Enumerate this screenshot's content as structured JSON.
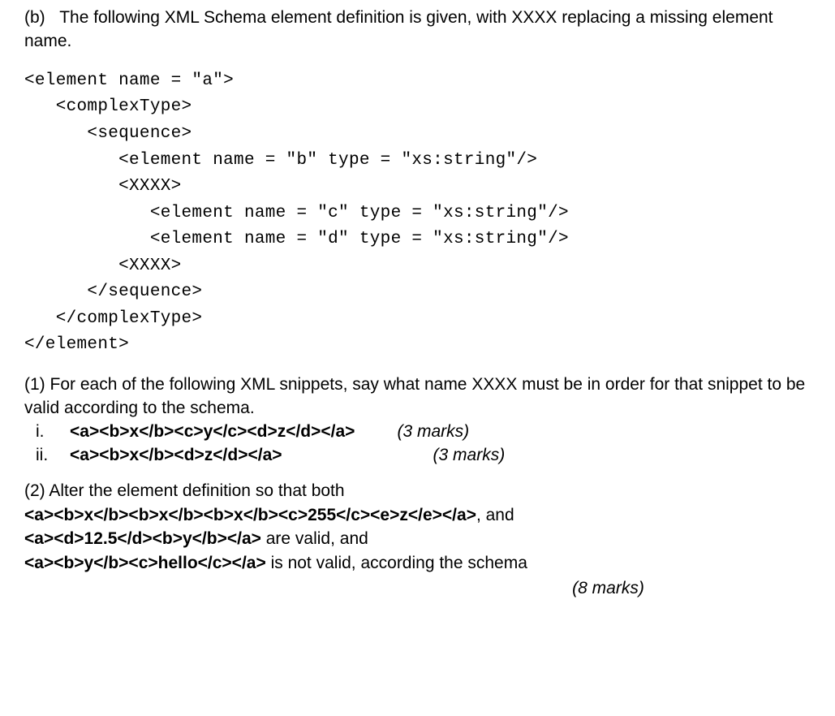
{
  "intro": {
    "label": "(b)",
    "text_part1": "The following XML Schema element definition is given, with XXXX replacing a missing element name."
  },
  "code": {
    "line1": "<element name = \"a\">",
    "line2": "   <complexType>",
    "line3": "      <sequence>",
    "line4": "         <element name = \"b\" type = \"xs:string\"/>",
    "line5": "         <XXXX>",
    "line6": "            <element name = \"c\" type = \"xs:string\"/>",
    "line7": "            <element name = \"d\" type = \"xs:string\"/>",
    "line8": "         <XXXX>",
    "line9": "      </sequence>",
    "line10": "   </complexType>",
    "line11": "</element>"
  },
  "q1": {
    "prompt": "(1) For each of the following XML snippets, say what name XXXX must be in order for that snippet to be valid according to the schema.",
    "items": [
      {
        "roman": "i.",
        "snippet": "<a><b>x</b><c>y</c><d>z</d></a>",
        "marks": "(3 marks)"
      },
      {
        "roman": "ii.",
        "snippet": "<a><b>x</b><d>z</d></a>",
        "marks": "(3 marks)"
      }
    ]
  },
  "q2": {
    "line1_prefix": "(2) Alter the element definition so that both",
    "line2_code": "<a><b>x</b><b>x</b><b>x</b><c>255</c><e>z</e></a>",
    "line2_suffix": ", and",
    "line3_code": "<a><d>12.5</d><b>y</b></a>",
    "line3_suffix": " are valid, and",
    "line4_code": "<a><b>y</b><c>hello</c></a>",
    "line4_suffix": " is not valid, according the schema",
    "marks": "(8 marks)"
  }
}
